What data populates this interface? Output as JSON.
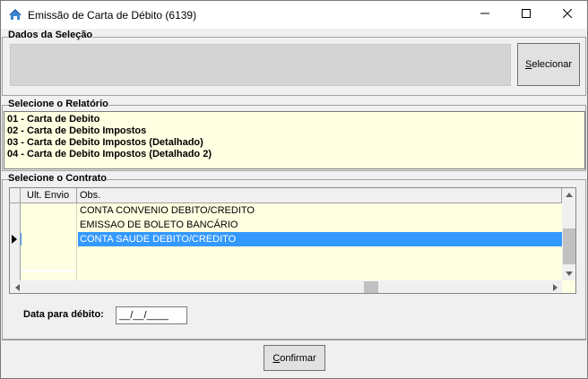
{
  "window": {
    "title": "Emissão de Carta de Débito (6139)",
    "icons": {
      "app": "app-logo-icon",
      "minimize": "minimize-icon",
      "maximize": "maximize-icon",
      "close": "close-icon"
    }
  },
  "selecao": {
    "group_label": "Dados da Seleção",
    "button_prefix_underlined": "S",
    "button_rest": "elecionar"
  },
  "relatorio": {
    "group_label": "Selecione o Relatório",
    "items": [
      "01 - Carta de Debito",
      "02 - Carta de Debito Impostos",
      "03 - Carta de Debito Impostos (Detalhado)",
      "04 - Carta de Debito Impostos (Detalhado 2)"
    ]
  },
  "contrato": {
    "group_label": "Selecione o Contrato",
    "columns": [
      "Ult. Envio",
      "Obs."
    ],
    "rows": [
      {
        "ult_envio": "",
        "obs": "CONTA CONVENIO DEBITO/CREDITO"
      },
      {
        "ult_envio": "",
        "obs": "EMISSAO DE BOLETO BANCÁRIO"
      },
      {
        "ult_envio": "",
        "obs": "CONTA SAUDE DEBITO/CREDITO",
        "selected": true
      }
    ]
  },
  "data_debito": {
    "label": "Data para débito:",
    "value": "__/__/____"
  },
  "footer": {
    "confirm_prefix_underlined": "C",
    "confirm_rest": "onfirmar"
  },
  "colors": {
    "list_background": "#ffffe1",
    "selection": "#3399ff",
    "window_background": "#f0f0f0"
  }
}
